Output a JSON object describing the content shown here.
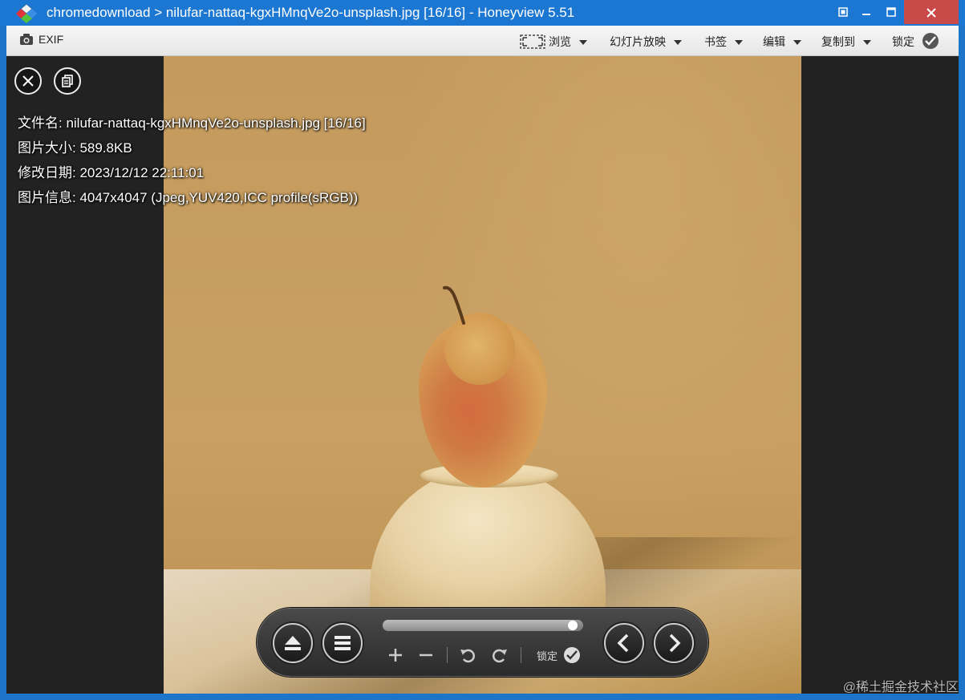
{
  "window": {
    "title": "chromedownload > nilufar-nattaq-kgxHMnqVe2o-unsplash.jpg [16/16] - Honeyview 5.51",
    "accent_color": "#1b77d2",
    "close_color": "#c94a48"
  },
  "toolbar": {
    "exif_label": "EXIF",
    "browse_label": "浏览",
    "slideshow_label": "幻灯片放映",
    "bookmark_label": "书签",
    "edit_label": "编辑",
    "copy_to_label": "复制到",
    "lock_label": "锁定"
  },
  "info": {
    "filename": "文件名: nilufar-nattaq-kgxHMnqVe2o-unsplash.jpg [16/16]",
    "filesize": "图片大小: 589.8KB",
    "modified": "修改日期: 2023/12/12 22:11:01",
    "imageinfo": "图片信息: 4047x4047 (Jpeg,YUV420,ICC profile(sRGB))"
  },
  "panel": {
    "progress": 0.97,
    "lock_label": "锁定"
  },
  "watermark": "@稀土掘金技术社区"
}
